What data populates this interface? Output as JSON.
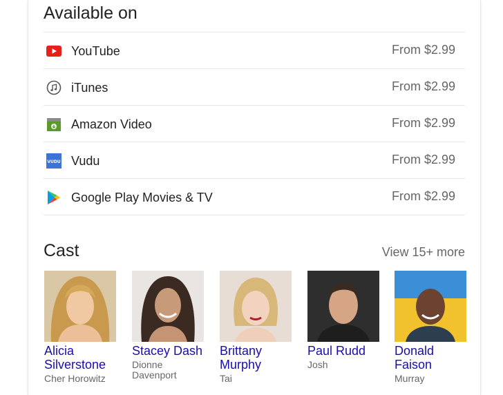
{
  "available": {
    "title": "Available on",
    "providers": [
      {
        "name": "YouTube",
        "price": "From $2.99",
        "icon": "youtube-icon"
      },
      {
        "name": "iTunes",
        "price": "From $2.99",
        "icon": "itunes-icon"
      },
      {
        "name": "Amazon Video",
        "price": "From $2.99",
        "icon": "amazon-video-icon"
      },
      {
        "name": "Vudu",
        "price": "From $2.99",
        "icon": "vudu-icon",
        "icon_text": "VUDU"
      },
      {
        "name": "Google Play Movies & TV",
        "price": "From $2.99",
        "icon": "google-play-icon"
      }
    ]
  },
  "cast": {
    "title": "Cast",
    "more_label": "View 15+ more",
    "members": [
      {
        "name": "Alicia Silverstone",
        "role": "Cher Horowitz"
      },
      {
        "name": "Stacey Dash",
        "role": "Dionne Davenport"
      },
      {
        "name": "Brittany Murphy",
        "role": "Tai"
      },
      {
        "name": "Paul Rudd",
        "role": "Josh"
      },
      {
        "name": "Donald Faison",
        "role": "Murray"
      }
    ]
  },
  "colors": {
    "link": "#1a0dab",
    "secondary_text": "#666666",
    "youtube_red": "#e62117",
    "amazon_green": "#5a9a2a",
    "vudu_blue": "#3b73d6"
  }
}
